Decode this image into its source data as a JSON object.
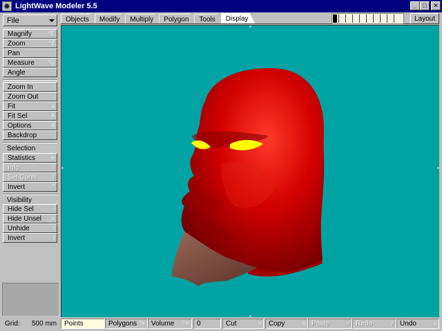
{
  "window": {
    "title": "LightWave Modeler 5.5",
    "minimize_glyph": "_",
    "maximize_glyph": "□",
    "close_glyph": "✕"
  },
  "file_menu": {
    "label": "File"
  },
  "tabs": [
    {
      "label": "Objects",
      "active": false
    },
    {
      "label": "Modify",
      "active": false
    },
    {
      "label": "Multiply",
      "active": false
    },
    {
      "label": "Polygon",
      "active": false
    },
    {
      "label": "Tools",
      "active": false
    },
    {
      "label": "Display",
      "active": true
    }
  ],
  "layout_button": {
    "label": "Layout"
  },
  "left_toolbar": {
    "view_tools": [
      {
        "label": "Magnify",
        "shortcut": "^E"
      },
      {
        "label": "Zoom",
        "shortcut": "^Z"
      },
      {
        "label": "Pan",
        "shortcut": ""
      },
      {
        "label": "Measure",
        "shortcut": "^Q"
      },
      {
        "label": "Angle",
        "shortcut": ""
      }
    ],
    "zoom_tools": [
      {
        "label": "Zoom In",
        "shortcut": "."
      },
      {
        "label": "Zoom Out",
        "shortcut": ","
      },
      {
        "label": "Fit",
        "shortcut": "a"
      },
      {
        "label": "Fit Sel",
        "shortcut": "A"
      },
      {
        "label": "Options",
        "shortcut": "d"
      },
      {
        "label": "Backdrop",
        "shortcut": ""
      }
    ],
    "selection_header": "Selection",
    "selection_tools": [
      {
        "label": "Statistics",
        "shortcut": "w",
        "disabled": false
      },
      {
        "label": "Info",
        "shortcut": "i",
        "disabled": true
      },
      {
        "label": "Sel Conn",
        "shortcut": "]",
        "disabled": true
      },
      {
        "label": "Invert",
        "shortcut": "\"",
        "disabled": false
      }
    ],
    "visibility_header": "Visibility",
    "visibility_tools": [
      {
        "label": "Hide Sel",
        "shortcut": "-"
      },
      {
        "label": "Hide Unsel",
        "shortcut": "="
      },
      {
        "label": "Unhide",
        "shortcut": "\\"
      },
      {
        "label": "Invert",
        "shortcut": "|"
      }
    ]
  },
  "viewport": {
    "background_color": "#00a3a3",
    "model": "red-head-model",
    "skin_color": "#d10000",
    "eye_color": "#ffff00",
    "beard_color": "#7a4a3a"
  },
  "statusbar": {
    "grid_label": "Grid:",
    "grid_value": "500 mm",
    "points_label": "Points",
    "polygons_label": "Polygons",
    "polygons_shortcut": "^+",
    "volume_label": "Volume",
    "volume_shortcut": "^V",
    "count_value": "0",
    "cut_label": "Cut",
    "cut_shortcut": "x",
    "copy_label": "Copy",
    "copy_shortcut": "c",
    "paste_label": "Paste",
    "paste_shortcut": "v",
    "redo_label": "Redo",
    "redo_shortcut": "z",
    "undo_label": "Undo",
    "undo_shortcut": "u"
  }
}
